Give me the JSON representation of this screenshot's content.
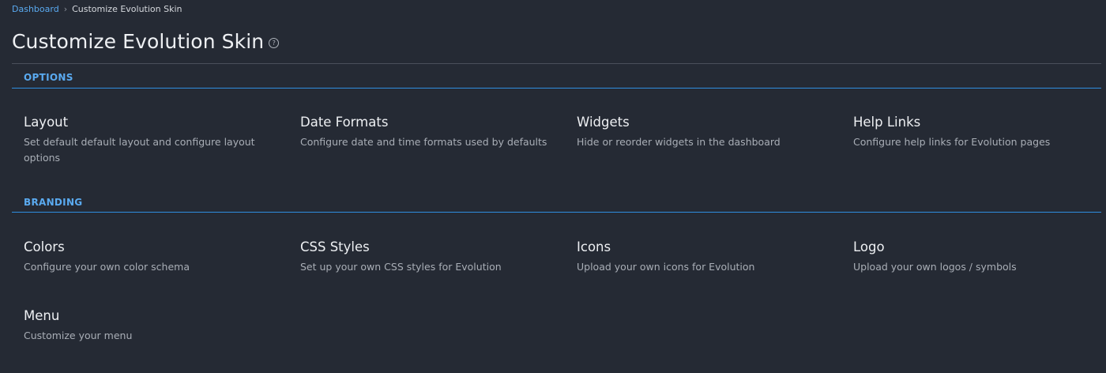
{
  "breadcrumb": {
    "home": "Dashboard",
    "separator": "›",
    "current": "Customize Evolution Skin"
  },
  "header": {
    "title": "Customize Evolution Skin",
    "help_icon": "question-circle-icon"
  },
  "sections": {
    "options": {
      "label": "OPTIONS",
      "cards": [
        {
          "title": "Layout",
          "description": "Set default default layout and configure layout options"
        },
        {
          "title": "Date Formats",
          "description": "Configure date and time formats used by defaults"
        },
        {
          "title": "Widgets",
          "description": "Hide or reorder widgets in the dashboard"
        },
        {
          "title": "Help Links",
          "description": "Configure help links for Evolution pages"
        }
      ]
    },
    "branding": {
      "label": "BRANDING",
      "cards": [
        {
          "title": "Colors",
          "description": "Configure your own color schema"
        },
        {
          "title": "CSS Styles",
          "description": "Set up your own CSS styles for Evolution"
        },
        {
          "title": "Icons",
          "description": "Upload your own icons for Evolution"
        },
        {
          "title": "Logo",
          "description": "Upload your own logos / symbols"
        },
        {
          "title": "Menu",
          "description": "Customize your menu"
        }
      ]
    }
  },
  "colors": {
    "background": "#252a34",
    "accent": "#5aaaf0",
    "section_line": "#2f8ee0"
  }
}
